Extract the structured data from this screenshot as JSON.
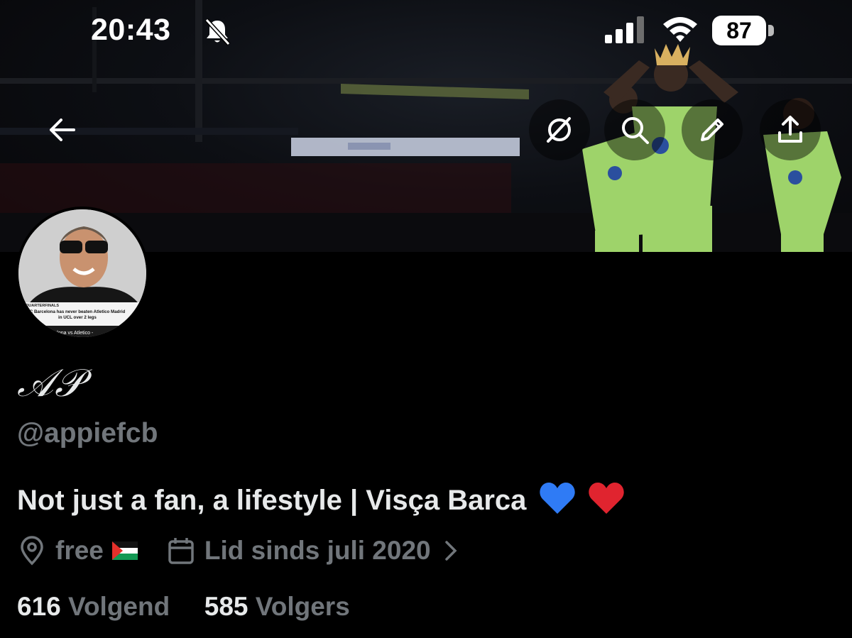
{
  "status_bar": {
    "time": "20:43",
    "battery": "87",
    "icons": [
      "bell-slash-icon",
      "cellular-signal-icon",
      "wifi-icon",
      "battery-icon"
    ]
  },
  "banner": {
    "actions": [
      "back-arrow-icon",
      "grok-icon",
      "search-icon",
      "edit-pencil-icon",
      "share-icon"
    ]
  },
  "avatar": {
    "overlay_text": [
      "QUARTERFINALS",
      "FC Barcelona has never beaten Atletico Madrid",
      "in UCL over 2 legs",
      "Barcelona vs Atletico - "
    ]
  },
  "profile": {
    "display_name": "𝒜𝒫",
    "handle": "@appiefcb",
    "bio": "Not just a fan, a lifestyle | Visça Barca",
    "bio_emoji": [
      "blue-heart-icon",
      "red-heart-icon"
    ],
    "location": "free",
    "joined": "Lid sinds juli 2020"
  },
  "stats": {
    "following_count": "616",
    "following_label": "Volgend",
    "followers_count": "585",
    "followers_label": "Volgers"
  },
  "colors": {
    "background": "#000000",
    "text_primary": "#e7e9ea",
    "text_secondary": "#71767b",
    "kit_green": "#9ed36a",
    "blue_heart": "#2f7bf5",
    "red_heart": "#e0242f"
  }
}
